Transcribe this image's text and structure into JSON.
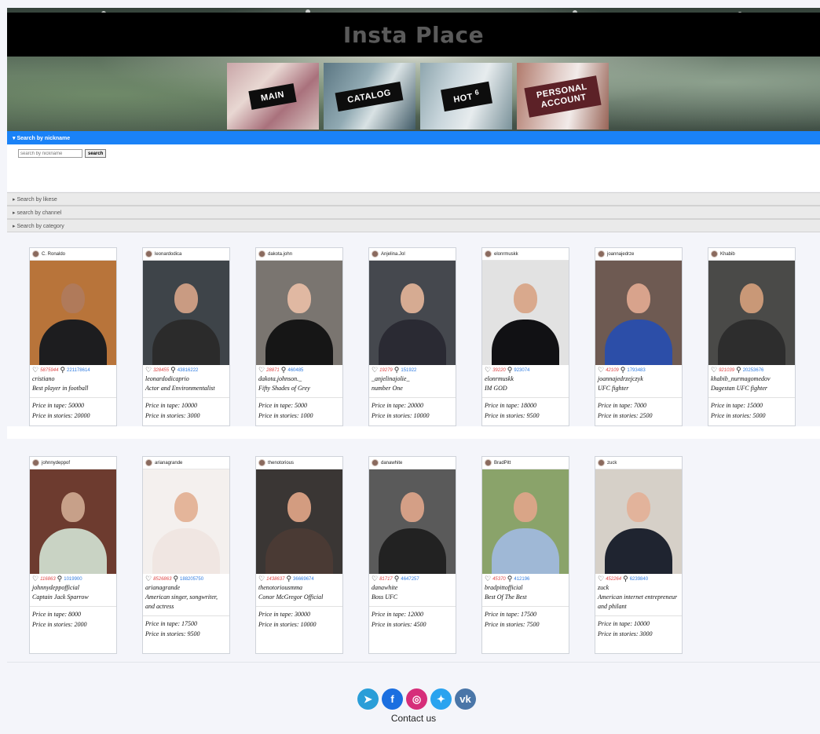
{
  "header": {
    "title": "Insta Place"
  },
  "nav": [
    {
      "label": "MAIN"
    },
    {
      "label": "CATALOG"
    },
    {
      "label": "HOT",
      "sup": "6"
    },
    {
      "label_line1": "PERSONAL",
      "label_line2": "ACCOUNT"
    }
  ],
  "search": {
    "nickname_header": "Search by nickname",
    "placeholder": "search by nickname",
    "button": "search",
    "likes_header": "Search by likese",
    "channel_header": "search by channel",
    "category_header": "Search by category"
  },
  "price_labels": {
    "tape": "Price in tape: ",
    "stories": "Price in stories: "
  },
  "cards_row1": [
    {
      "username": "C. Ronaldo",
      "likes": "5875944",
      "subs": "221178614",
      "nick": "cristiano",
      "desc": "Best player in football",
      "tape": "50000",
      "stories": "20000",
      "skin": "#b07a5a",
      "cloth": "#1d1d1f",
      "bg": "#b8743a"
    },
    {
      "username": "leonardodica",
      "likes": "328455",
      "subs": "43816222",
      "nick": "leonardodicaprio",
      "desc": "Actor and Environmentalist",
      "tape": "10000",
      "stories": "3000",
      "skin": "#c99b82",
      "cloth": "#2b2b2b",
      "bg": "#3e4449"
    },
    {
      "username": "dakota.john",
      "likes": "28871",
      "subs": "460485",
      "nick": "dakota.johnson._",
      "desc": "Fifty Shades of Grey",
      "tape": "5000",
      "stories": "1000",
      "skin": "#e0b8a2",
      "cloth": "#161616",
      "bg": "#7a7570"
    },
    {
      "username": "Anjelina.Jol",
      "likes": "19279",
      "subs": "151922",
      "nick": "_anjelinajolie_",
      "desc": "number One",
      "tape": "20000",
      "stories": "10000",
      "skin": "#d6ab92",
      "cloth": "#2a2a33",
      "bg": "#45484e"
    },
    {
      "username": "elonrmuskk",
      "likes": "39220",
      "subs": "923074",
      "nick": "elonrmuskk",
      "desc": "IM GOD",
      "tape": "18000",
      "stories": "9500",
      "skin": "#d9a98d",
      "cloth": "#111114",
      "bg": "#e2e2e2"
    },
    {
      "username": "joannajedrze",
      "likes": "42109",
      "subs": "1793483",
      "nick": "joannajedrzejczyk",
      "desc": "UFC fighter",
      "tape": "7000",
      "stories": "2500",
      "skin": "#d8a38c",
      "cloth": "#2c4ea8",
      "bg": "#6e5a52"
    },
    {
      "username": "Khabib",
      "likes": "921039",
      "subs": "20253676",
      "nick": "khabib_nurmagomedov",
      "desc": "Dagestan UFC fighter",
      "tape": "15000",
      "stories": "5000",
      "skin": "#c99877",
      "cloth": "#2d2d2d",
      "bg": "#4a4a48"
    }
  ],
  "cards_row2": [
    {
      "username": "johnnydeppof",
      "likes": "116863",
      "subs": "1019900",
      "nick": "johnnydeppofficial",
      "desc": "Captain Jack Sparrow",
      "tape": "8000",
      "stories": "2000",
      "skin": "#c7a089",
      "cloth": "#c9d3c4",
      "bg": "#6d3b2f"
    },
    {
      "username": "arianagrande",
      "likes": "8526863",
      "subs": "188205750",
      "nick": "arianagrande",
      "desc": "American singer, songwriter, and actress",
      "tape": "17500",
      "stories": "9500",
      "skin": "#e4b59a",
      "cloth": "#f0e6e2",
      "bg": "#f4f0ee"
    },
    {
      "username": "thenotorious",
      "likes": "1438637",
      "subs": "36669674",
      "nick": "thenotoriousmma",
      "desc": "Conor McGregor Official",
      "tape": "30000",
      "stories": "10000",
      "skin": "#d39c80",
      "cloth": "#4a3a34",
      "bg": "#3a3634"
    },
    {
      "username": "danawhite",
      "likes": "81717",
      "subs": "4647257",
      "nick": "danawhite",
      "desc": "Boss UFC",
      "tape": "12000",
      "stories": "4500",
      "skin": "#d49f86",
      "cloth": "#222222",
      "bg": "#5a5a5a"
    },
    {
      "username": "BradPitt",
      "likes": "45370",
      "subs": "412196",
      "nick": "bradpittofficial",
      "desc": "Best Of The Best",
      "tape": "17500",
      "stories": "7500",
      "skin": "#d9a587",
      "cloth": "#9fb8d6",
      "bg": "#8aa36a"
    },
    {
      "username": "zuck",
      "likes": "452264",
      "subs": "6239840",
      "nick": "zuck",
      "desc": "American internet entrepreneur and philant",
      "tape": "10000",
      "stories": "3000",
      "skin": "#e2b39b",
      "cloth": "#1f2430",
      "bg": "#d6d0c8"
    }
  ],
  "socials": [
    {
      "name": "telegram",
      "glyph": "➤",
      "color": "#2a9ed8"
    },
    {
      "name": "facebook",
      "glyph": "f",
      "color": "#1b6fe0"
    },
    {
      "name": "instagram",
      "glyph": "◎",
      "color": "#d62e7a"
    },
    {
      "name": "twitter",
      "glyph": "✦",
      "color": "#2aa3ef"
    },
    {
      "name": "vk",
      "glyph": "vk",
      "color": "#4a76a8"
    }
  ],
  "footer": {
    "contact": "Contact us"
  }
}
